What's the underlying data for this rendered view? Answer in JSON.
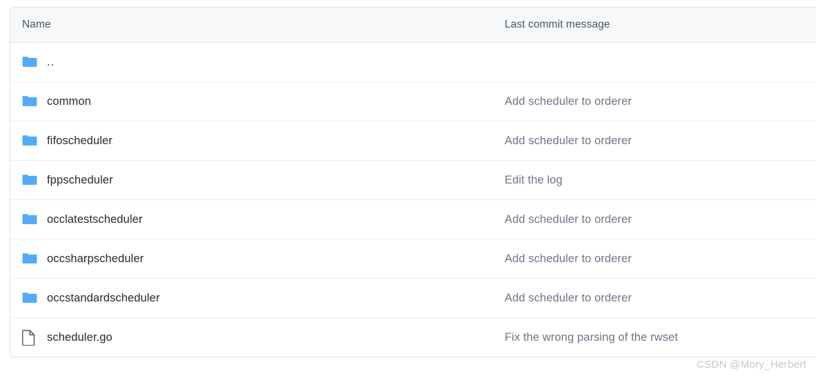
{
  "table": {
    "columns": {
      "name": "Name",
      "last_commit_message": "Last commit message"
    },
    "rows": [
      {
        "icon": "folder-icon",
        "name": "..",
        "commit_message": ""
      },
      {
        "icon": "folder-icon",
        "name": "common",
        "commit_message": "Add scheduler to orderer"
      },
      {
        "icon": "folder-icon",
        "name": "fifoscheduler",
        "commit_message": "Add scheduler to orderer"
      },
      {
        "icon": "folder-icon",
        "name": "fppscheduler",
        "commit_message": "Edit the log"
      },
      {
        "icon": "folder-icon",
        "name": "occlatestscheduler",
        "commit_message": "Add scheduler to orderer"
      },
      {
        "icon": "folder-icon",
        "name": "occsharpscheduler",
        "commit_message": "Add scheduler to orderer"
      },
      {
        "icon": "folder-icon",
        "name": "occstandardscheduler",
        "commit_message": "Add scheduler to orderer"
      },
      {
        "icon": "file-icon",
        "name": "scheduler.go",
        "commit_message": "Fix the wrong parsing of the rwset"
      }
    ]
  },
  "watermark": {
    "text": "CSDN @Mory_Herbert"
  },
  "colors": {
    "folder_icon": "#54aaf5",
    "file_icon": "#586069",
    "header_background": "#f6f8fa",
    "header_text": "#4a5568",
    "name_text": "#24292e",
    "commit_text": "#6a7687",
    "row_divider": "#eaecef",
    "table_border": "#dfe2e5",
    "watermark_text": "#c7c7c7"
  }
}
